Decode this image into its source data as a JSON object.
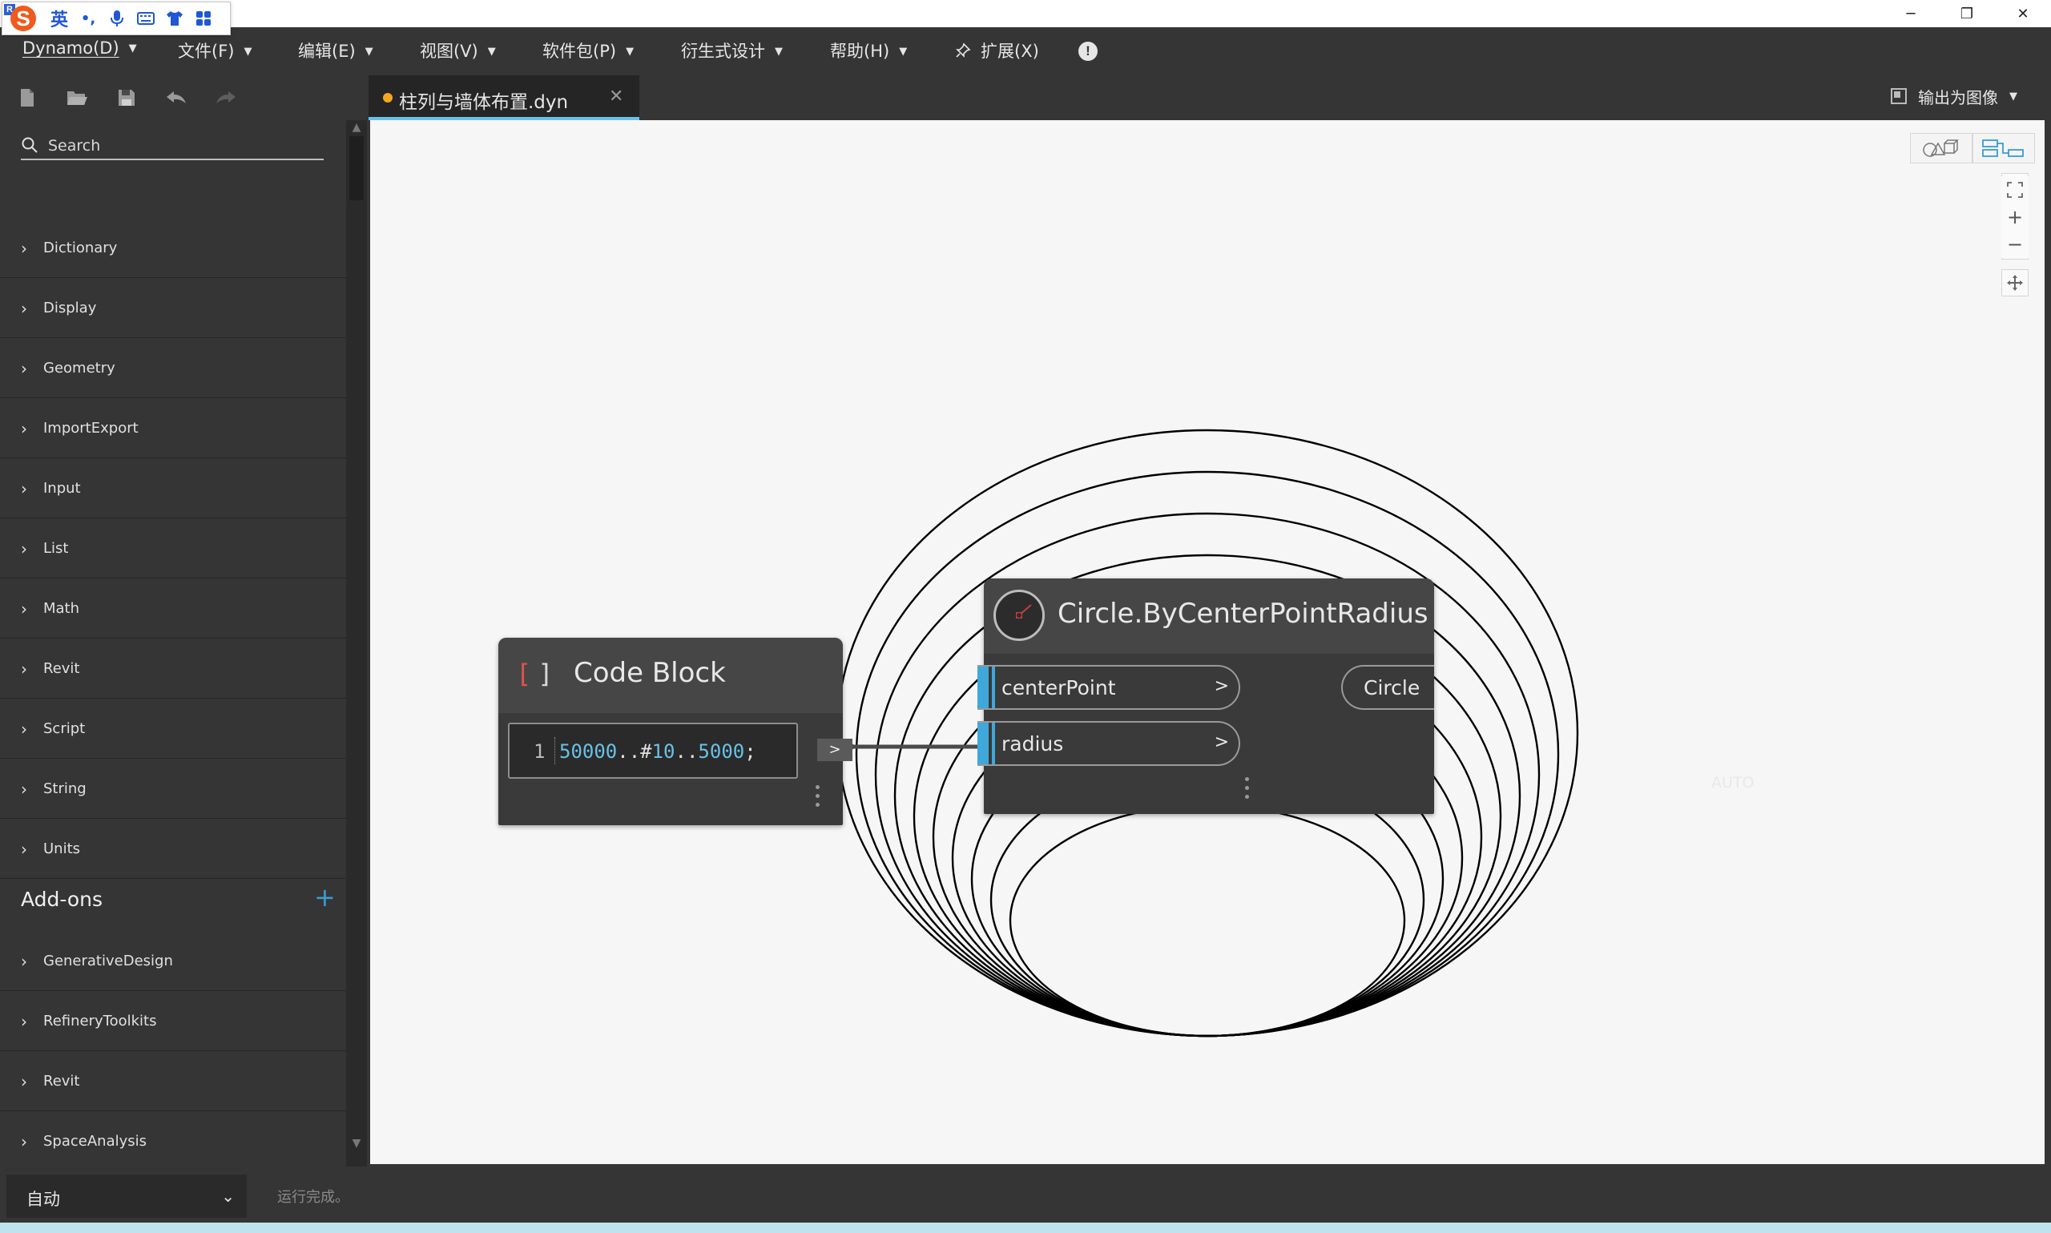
{
  "ime": {
    "lang_label": "英",
    "punct_label": "•,"
  },
  "window_controls": {
    "minimize": "─",
    "restore": "❐",
    "close": "✕"
  },
  "menu": [
    {
      "label": "Dynamo(D)"
    },
    {
      "label": "文件(F)"
    },
    {
      "label": "编辑(E)"
    },
    {
      "label": "视图(V)"
    },
    {
      "label": "软件包(P)"
    },
    {
      "label": "衍生式设计"
    },
    {
      "label": "帮助(H)"
    },
    {
      "label": "扩展(X)"
    }
  ],
  "menu_arrow": "▼",
  "tab": {
    "filename": "柱列与墙体布置.dyn",
    "close": "✕",
    "modified_color": "#f5a623"
  },
  "export": {
    "label": "输出为图像",
    "arrow": "▼"
  },
  "library": {
    "search_placeholder": "Search",
    "chevron": "›",
    "categories": [
      "Dictionary",
      "Display",
      "Geometry",
      "ImportExport",
      "Input",
      "List",
      "Math",
      "Revit",
      "Script",
      "String",
      "Units"
    ],
    "addons_title": "Add-ons",
    "addons_plus": "+",
    "addons": [
      "GenerativeDesign",
      "RefineryToolkits",
      "Revit",
      "SpaceAnalysis"
    ]
  },
  "code_block": {
    "title": "Code Block",
    "icon_left": "[",
    "icon_right": "]",
    "line_number": "1",
    "code_tokens": [
      {
        "text": "50000",
        "kind": "num"
      },
      {
        "text": "..#",
        "kind": "op"
      },
      {
        "text": "10",
        "kind": "num"
      },
      {
        "text": "..",
        "kind": "op"
      },
      {
        "text": "5000",
        "kind": "num"
      },
      {
        "text": ";",
        "kind": "op"
      }
    ],
    "output_port": ">"
  },
  "circle_node": {
    "title": "Circle.ByCenterPointRadius",
    "inputs": [
      {
        "label": "centerPoint",
        "arrow": ">"
      },
      {
        "label": "radius",
        "arrow": ">"
      }
    ],
    "output": "Circle",
    "lacing": "AUTO"
  },
  "preview": {
    "circle_count": 10,
    "stroke_color": "#000000"
  },
  "status": {
    "run_mode": "自动",
    "run_status": "运行完成。"
  },
  "colors": {
    "accent": "#3fa7d9",
    "tab_underline": "#6ac0e7",
    "chrome": "#353535",
    "canvas": "#f6f6f6"
  }
}
